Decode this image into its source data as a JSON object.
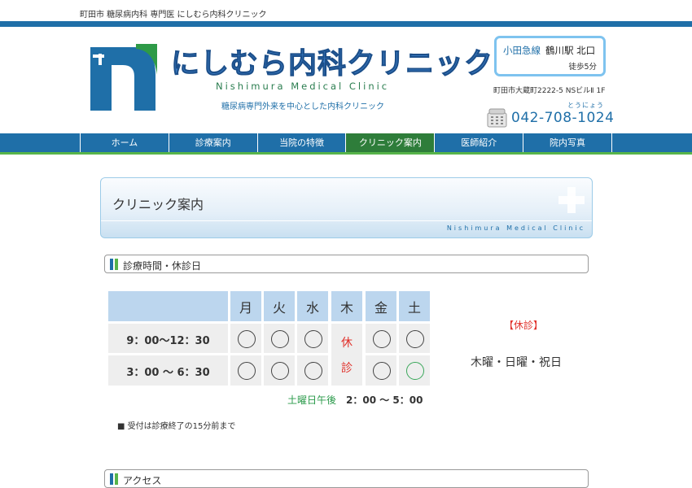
{
  "header": {
    "tagline": "町田市 糖尿病内科 専門医 にしむら内科クリニック",
    "logo_title": "にしむら内科クリニック",
    "logo_subtitle": "Nishimura Medical Clinic",
    "logo_description": "糖尿病専門外来を中心とした内科クリニック",
    "access": {
      "line": "小田急線",
      "station": "鶴川駅 北口",
      "walk": "徒歩5分"
    },
    "address": "町田市大蔵町2222-5 NSビルⅡ 1F",
    "phone_ruby": "とうにょう",
    "phone": "042-708-1024",
    "colors": {
      "brand_blue": "#1f6fa8",
      "brand_green": "#57b44a",
      "active_nav": "#2e7d3a"
    }
  },
  "nav": {
    "items": [
      {
        "label": "ホーム"
      },
      {
        "label": "診療案内"
      },
      {
        "label": "当院の特徴"
      },
      {
        "label": "クリニック案内"
      },
      {
        "label": "医師紹介"
      },
      {
        "label": "院内写真"
      }
    ],
    "active_index": 3
  },
  "page": {
    "title": "クリニック案内",
    "subtitle": "Nishimura Medical Clinic"
  },
  "section_hours": {
    "label": "診療時間・休診日",
    "days": [
      "月",
      "火",
      "水",
      "木",
      "金",
      "土"
    ],
    "rows": [
      {
        "time": "9：00〜12：30",
        "slots": [
          "open",
          "open",
          "open",
          "closed",
          "open",
          "open"
        ]
      },
      {
        "time": "3：00 〜 6：30",
        "slots": [
          "open",
          "open",
          "open",
          "closed",
          "open",
          "saturday"
        ]
      }
    ],
    "closed_text": [
      "休",
      "診"
    ],
    "saturday_note": {
      "label": "土曜日午後",
      "time": "2：00 〜 5：00"
    },
    "reception_note": "■ 受付は診療終了の15分前まで",
    "holiday_label": "【休診】",
    "holiday_days": "木曜・日曜・祝日"
  },
  "section_access": {
    "label": "アクセス"
  }
}
